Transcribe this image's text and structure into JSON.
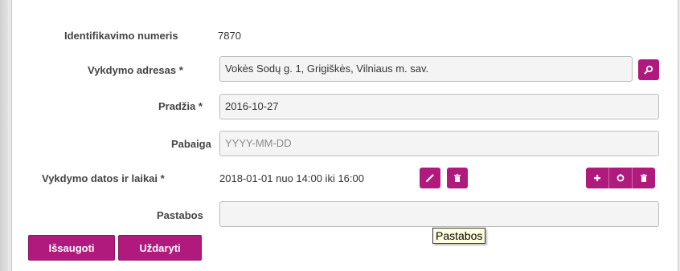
{
  "form": {
    "id_label": "Identifikavimo numeris",
    "id_value": "7870",
    "address_label": "Vykdymo adresas *",
    "address_value": "Vokės Sodų g. 1, Grigiškės, Vilniaus m. sav.",
    "start_label": "Pradžia *",
    "start_value": "2016-10-27",
    "end_label": "Pabaiga",
    "end_placeholder": "YYYY-MM-DD",
    "dates_label": "Vykdymo datos ir laikai *",
    "dates_value": "2018-01-01 nuo 14:00 iki 16:00",
    "notes_label": "Pastabos",
    "notes_value": ""
  },
  "icons": {
    "search": "search-icon",
    "edit": "pencil-icon",
    "delete": "trash-icon",
    "add": "plus-icon",
    "refresh": "refresh-icon"
  },
  "buttons": {
    "save_label": "Išsaugoti",
    "close_label": "Uždaryti"
  },
  "tooltip": {
    "text": "Pastabos"
  },
  "colors": {
    "accent": "#b01a7d"
  }
}
